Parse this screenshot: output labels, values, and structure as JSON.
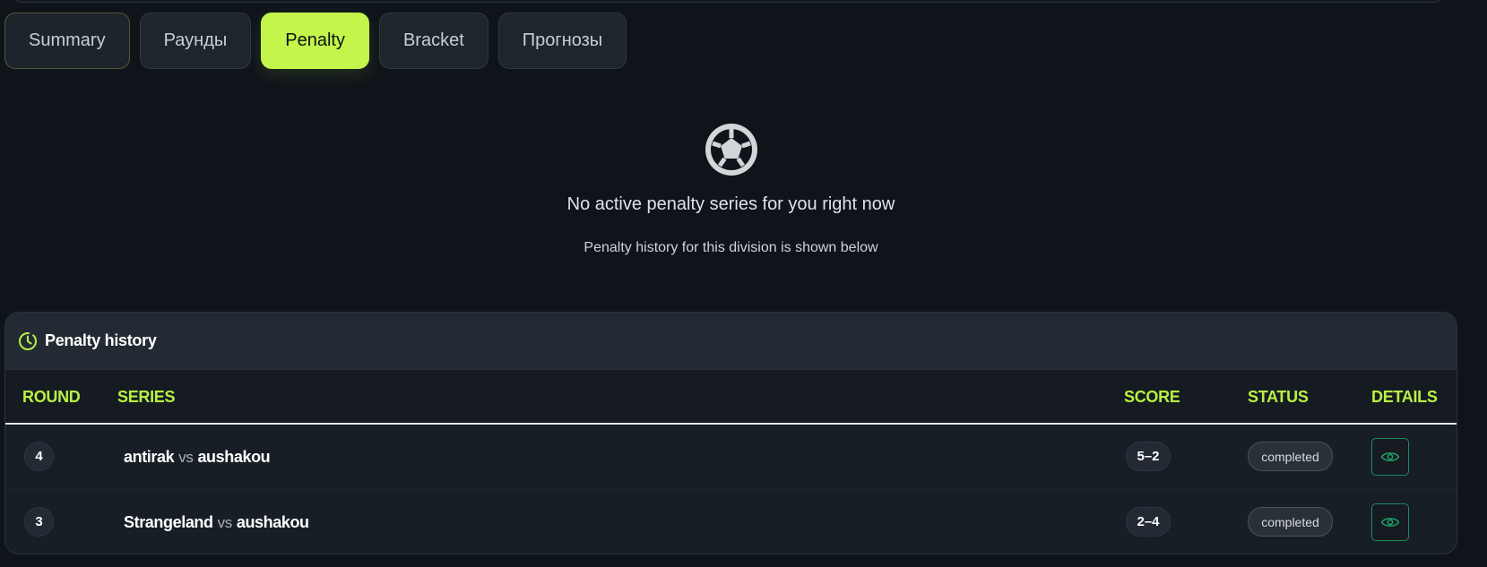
{
  "tabs": [
    {
      "label": "Summary"
    },
    {
      "label": "Раунды"
    },
    {
      "label": "Penalty",
      "active": true
    },
    {
      "label": "Bracket"
    },
    {
      "label": "Прогнозы"
    }
  ],
  "empty_state": {
    "icon": "soccer-ball-icon",
    "title": "No active penalty series for you right now",
    "subtitle": "Penalty history for this division is shown below"
  },
  "history": {
    "icon": "clock-icon",
    "title": "Penalty history",
    "columns": {
      "round": "ROUND",
      "series": "SERIES",
      "score": "SCORE",
      "status": "STATUS",
      "details": "DETAILS"
    },
    "vs_label": "vs",
    "rows": [
      {
        "round": "4",
        "player1": "antirak",
        "player2": "aushakou",
        "score": "5–2",
        "status": "completed",
        "details_icon": "eye-icon"
      },
      {
        "round": "3",
        "player1": "Strangeland",
        "player2": "aushakou",
        "score": "2–4",
        "status": "completed",
        "details_icon": "eye-icon"
      }
    ]
  },
  "colors": {
    "accent": "#c3f54a",
    "background": "#0f141a",
    "panel": "#181e26",
    "details_border": "#1f8a5c"
  }
}
